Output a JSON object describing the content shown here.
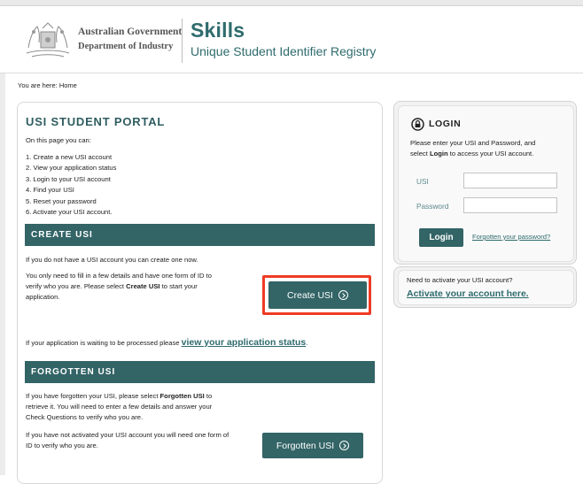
{
  "header": {
    "gov_line1": "Australian Government",
    "gov_line2": "Department of Industry",
    "brand": "Skills",
    "brand_sub": "Unique Student Identifier Registry"
  },
  "breadcrumb": "You are here:  Home",
  "portal": {
    "title": "USI STUDENT PORTAL",
    "intro": "On this page you can:",
    "steps": [
      "1. Create a new USI account",
      "2. View your application status",
      "3. Login to your USI account",
      "4. Find your USI",
      "5. Reset your password",
      "6. Activate your USI account."
    ]
  },
  "create": {
    "heading": "CREATE USI",
    "p1": "If you do not have a USI account you can create one now.",
    "p2_a": "You only need to fill in a few details and have one form of ID to",
    "p2_b": "verify who you are. Please select ",
    "p2_bold": "Create USI",
    "p2_c": " to start your",
    "p2_d": "application.",
    "button": "Create USI",
    "pending_text": "If your application is waiting to be processed please ",
    "pending_link": "view your application status",
    "pending_end": "."
  },
  "forgotten": {
    "heading": "FORGOTTEN USI",
    "p1_a": "If you have forgotten your USI, please select ",
    "p1_bold": "Forgotten USI",
    "p1_b": " to",
    "p1_c": "retrieve it. You will need to enter a few details and answer your",
    "p1_d": "Check Questions to verify who you are.",
    "p2_a": "If you have not activated your USI account you will need one form of",
    "p2_b": "ID to verify who you are.",
    "button": "Forgotten USI"
  },
  "login": {
    "title": "LOGIN",
    "desc_a": "Please enter your USI and Password, and",
    "desc_b": "select ",
    "desc_bold": "Login",
    "desc_c": " to access your USI account.",
    "usi_label": "USI",
    "password_label": "Password",
    "button": "Login",
    "forgot_link": "Forgotten your password?"
  },
  "activate": {
    "question": "Need to activate your USI account?",
    "link": "Activate your account here."
  },
  "colors": {
    "brand_teal": "#336466",
    "link_teal": "#2f6b6d",
    "highlight_red": "#ef3b24"
  }
}
